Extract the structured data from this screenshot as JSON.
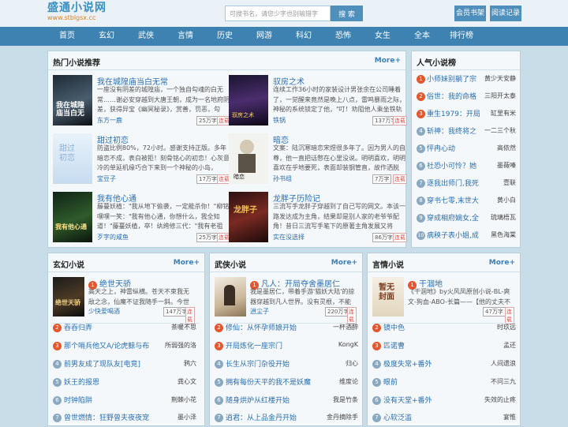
{
  "header": {
    "logo_main": "盛通小说网",
    "logo_sub": "www.stblgsx.cc",
    "search_placeholder": "可搜书名，请您少字也别输错字",
    "search_button": "搜 索",
    "member_button": "会员书架",
    "history_button": "阅读记录"
  },
  "nav": [
    "首页",
    "玄幻",
    "武侠",
    "言情",
    "历史",
    "网游",
    "科幻",
    "恐怖",
    "女生",
    "全本",
    "排行榜"
  ],
  "hot": {
    "title": "热门小说推荐",
    "more": "More+",
    "books": [
      {
        "title": "我在城隍庙当白无常",
        "desc": "一座没有阴差的城隍庙，一个独自勾魂的白无常……谢必安穿越到大唐王朝，成为一名地府阴差，获得异宝《幽冥秘录》，赏善，罚恶，勾魂……",
        "author": "东方一鹿",
        "words": "25万字",
        "status": "连载"
      },
      {
        "title": "驭房之术",
        "desc": "连续工作36小时的家装设计男张余在公司睡着了，一觉醒来竟然是晚上八点，雷鸣暴雨之际，神秘的系统锁定了他，\"叮！劝阻他人乘坐铁轨",
        "author": "铁锅",
        "words": "137万字",
        "status": "连载"
      },
      {
        "title": "甜过初恋",
        "desc": "防盗比例80%，72小时。感谢支持正版。多年暗恋不成，表白被拒！刻骨铭心的初恋！心灰意冷的单延机缘巧合下来到一个神秘的小岛，",
        "author": "宝豆子",
        "words": "17万字",
        "status": "连载"
      },
      {
        "title": "暗恋",
        "desc": "文案：陆沉寒暗恋宋煜很多年了。因为男人的自尊，他一直把话憋在心里没说。明明喜欢，明明喜欢在乎地要死，表面却装钢管直，故作洒脱",
        "author": "孙书组",
        "words": "7万字",
        "status": "连载"
      },
      {
        "title": "我有他心通",
        "desc": "藤蔓妖植：\"我从地下偷袭，一定能杀你！\"柳铭嘿嘿一笑：\"我有他心通，你想什么，我全知道！\"藤蔓妖植，卒！纨绔修三代：\"我有老祖",
        "author": "歹字的咸鱼",
        "words": "25万字",
        "status": "连载"
      },
      {
        "title": "龙胖子历险记",
        "desc": "三流写手龙胖子穿越到了自己写的网文。本该一路发达成为主角，结果却是别人家的老爷爷配角！昔日三流写手笔下的原著主角发展又将",
        "author": "实在没选择",
        "words": "86万字",
        "status": "连载"
      }
    ]
  },
  "popular": {
    "title": "人气小说榜",
    "items": [
      {
        "name": "小师妹别躺了宗",
        "author": "黄少天安静"
      },
      {
        "name": "俗世：我的命格",
        "author": "三阳开太泰"
      },
      {
        "name": "重生1979：开局",
        "author": "缸里有米"
      },
      {
        "name": "斩神：我终将之",
        "author": "一二三个秋"
      },
      {
        "name": "怦冉心动",
        "author": "高侬然"
      },
      {
        "name": "社恐小可怜？她",
        "author": "墨薇嗪"
      },
      {
        "name": "逐我出师门,我死",
        "author": "壹联"
      },
      {
        "name": "穿书七零,末世大",
        "author": "黄小白"
      },
      {
        "name": "穿成相府嫡女,全",
        "author": "琉璃梧瓦"
      },
      {
        "name": "病秧子表小姐,成",
        "author": "黑色海棠"
      }
    ]
  },
  "sections": [
    {
      "title": "玄幻小说",
      "more": "More+",
      "feature": {
        "title": "绝世天骄",
        "desc": "高天之上，神雷纵横。苍天不束我无敌之念，仙魔不证我随手一斜。今世我执天",
        "author": "少快爱喝酒",
        "words": "147万字",
        "status": "连载"
      },
      "list": [
        {
          "name": "吞吞归弄",
          "author": "茶暖不思"
        },
        {
          "name": "那个哨兵他又A/论虎鲸与布",
          "author": "所弱强的洛"
        },
        {
          "name": "前男友成了现队友[电竞]",
          "author": "鸦六"
        },
        {
          "name": "妖王的报恩",
          "author": "龚心文"
        },
        {
          "name": "时钟陷阱",
          "author": "荆棘小花"
        },
        {
          "name": "曾世燃情：狂野曾夫夜夜宠",
          "author": "墨小泽"
        }
      ]
    },
    {
      "title": "武侠小说",
      "more": "More+",
      "feature": {
        "title": "凡人：开局夺舍墨居仁",
        "desc": "我是墨居仁，带着手游'猫妖大陆'的掠器穿越到凡人世界。没有灵根，不能",
        "author": "逍尘子",
        "words": "220万字",
        "status": "连载"
      },
      "list": [
        {
          "name": "修仙：从怀孕师娘开始",
          "author": "一杯酒醉"
        },
        {
          "name": "开局炼化一座宗门",
          "author": "KongK"
        },
        {
          "name": "长生从宗门杂役开始",
          "author": "归心"
        },
        {
          "name": "拥有每份天平的我不是妖魔",
          "author": "维度论"
        },
        {
          "name": "随身烘炉从红楼开始",
          "author": "我是竹条"
        },
        {
          "name": "逍君：从上品金丹开始",
          "author": "金丹摘除手"
        }
      ]
    },
    {
      "title": "言情小说",
      "more": "More+",
      "feature": {
        "title": "干涸地",
        "desc": "《干涸地》by火风凤原创小说-BL-爽文-狗血-ABO-长篇——【他的丈夫不想碰火风L",
        "author": "",
        "words": "47万字",
        "status": "连载"
      },
      "list": [
        {
          "name": "镜中色",
          "author": "时玖远"
        },
        {
          "name": "匹诺曹",
          "author": "孟还"
        },
        {
          "name": "极度失常+番外",
          "author": "人间遗浪"
        },
        {
          "name": "眼前",
          "author": "不问三九"
        },
        {
          "name": "没有天堂+番外",
          "author": "失效的止疼"
        },
        {
          "name": "心软泛滥",
          "author": "宴惟"
        }
      ]
    }
  ],
  "colors": {
    "accent": "#3d82b0",
    "rank_top": "#e4572e",
    "rank_other": "#8aa9c0",
    "link": "#2a6fb0",
    "status": "#d9534f"
  }
}
